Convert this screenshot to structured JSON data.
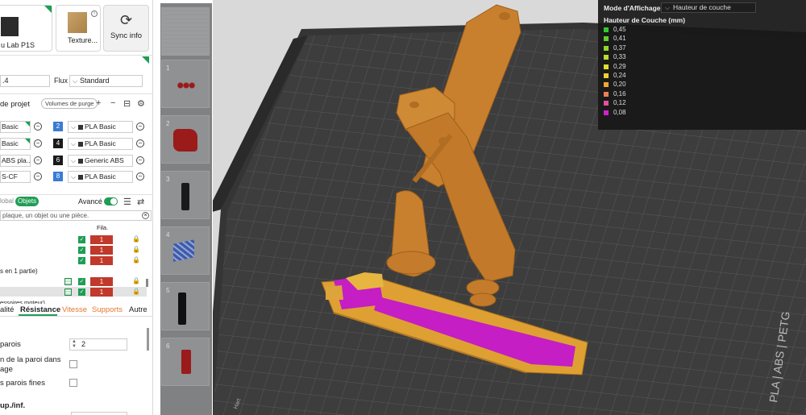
{
  "printer": {
    "name": "u Lab P1S",
    "plate_type": "Texture...",
    "sync_label": "Sync info",
    "info_mark": "i"
  },
  "nozzle": {
    "value": ".4",
    "flux_label": "Flux",
    "flux_value": "Standard"
  },
  "project": {
    "title": "de projet",
    "purge_button": "Volumes de purge"
  },
  "filaments": {
    "left": [
      {
        "label": "Basic",
        "flag": true
      },
      {
        "label": "Basic",
        "flag": true
      },
      {
        "label": "ABS pla...",
        "flag": false
      },
      {
        "label": "S-CF",
        "flag": false
      }
    ],
    "right": [
      {
        "num": "2",
        "num_color": "#3a7bd5",
        "label": "PLA Basic"
      },
      {
        "num": "4",
        "num_color": "#1a1a1a",
        "label": "PLA Basic"
      },
      {
        "num": "6",
        "num_color": "#1a1a1a",
        "label": "Generic ABS"
      },
      {
        "num": "8",
        "num_color": "#3a7bd5",
        "label": "PLA Basic"
      }
    ]
  },
  "modes": {
    "global": "lobal",
    "objects": "Objets",
    "advanced": "Avancé"
  },
  "search": {
    "placeholder": "plaque, un objet ou une pièce."
  },
  "object_list": {
    "fila_header": "Fila.",
    "fil_value": "1",
    "parts_label": "s en 1 partie)",
    "accessories_label": "essoires moteur)"
  },
  "settings_tabs": {
    "quality": "alité",
    "strength": "Résistance",
    "speed": "Vitesse",
    "supports": "Supports",
    "other": "Autre"
  },
  "settings": {
    "walls_label": "parois",
    "walls_value": "2",
    "wall_order_line1": "n de la paroi dans",
    "wall_order_line2": "age",
    "thin_walls_label": "s parois fines",
    "top_bottom_label": "up./inf."
  },
  "plates": [
    "1",
    "2",
    "3",
    "4",
    "5",
    "6"
  ],
  "legend": {
    "mode_label": "Mode d'Affichage",
    "mode_value": "Hauteur de couche",
    "title": "Hauteur de Couche (mm)",
    "items": [
      {
        "value": "0,45",
        "color": "#2ecc2e"
      },
      {
        "value": "0,41",
        "color": "#5fd12a"
      },
      {
        "value": "0,37",
        "color": "#8fd828"
      },
      {
        "value": "0,33",
        "color": "#b8de2a"
      },
      {
        "value": "0,29",
        "color": "#dde02c"
      },
      {
        "value": "0,24",
        "color": "#f0d02e"
      },
      {
        "value": "0,20",
        "color": "#f0a830"
      },
      {
        "value": "0,16",
        "color": "#ec7f5a"
      },
      {
        "value": "0,12",
        "color": "#e64f9a"
      },
      {
        "value": "0,08",
        "color": "#d21fd2"
      }
    ]
  },
  "bed_label": "PLA | ABS | PETG",
  "colors": {
    "accent": "#1f9d55",
    "model": "#c9802e",
    "highlight": "#c41ec4",
    "filament_red": "#c0392b"
  }
}
